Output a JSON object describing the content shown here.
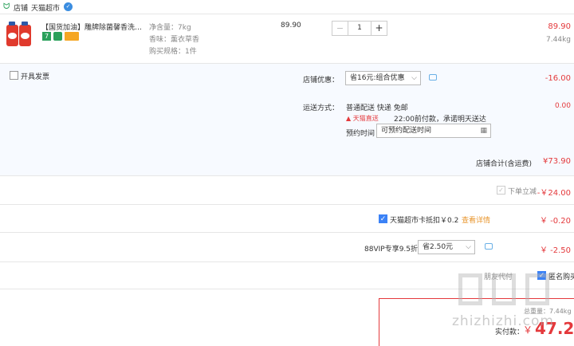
{
  "shop": {
    "icon": "tmall-cat-icon",
    "label": "店铺",
    "name": "天猫超市"
  },
  "item": {
    "title": "【国货加油】雕牌除菌馨香洗…",
    "spec1": "净含量：7kg",
    "spec2": "香味：薰衣草香",
    "spec3": "购买规格：1件",
    "unit_price": "89.90",
    "quantity": "1",
    "subtotal": "89.90",
    "weight": "7.44kg"
  },
  "invoice": {
    "label": "开具发票"
  },
  "discount": {
    "label": "店铺优惠：",
    "selected": "省16元:组合优惠",
    "amount": "-16.00"
  },
  "shipping": {
    "label": "运送方式：",
    "method": "普通配送 快递 免邮",
    "tmall_badge": "天猫直送",
    "promise": "22:00前付款，承诺明天送达",
    "appoint_label": "预约时间",
    "appoint_placeholder": "可预约配送时间",
    "amount": "0.00"
  },
  "shop_total": {
    "label": "店铺合计(含运费)",
    "amount": "¥73.90"
  },
  "instant": {
    "label": "下单立减",
    "amount": "-￥24.00"
  },
  "card": {
    "label": "天猫超市卡抵扣￥0.2",
    "link": "查看详情",
    "amount": "￥ -0.20"
  },
  "vip": {
    "label": "88VIP专享9.5折",
    "selected": "省2.50元",
    "amount": "￥ -2.50"
  },
  "footer": {
    "friend_pay": "朋友代付",
    "anon": "匿名购买",
    "weight": "总重量：7.44kg",
    "pay_label": "实付款：",
    "pay_currency": "￥",
    "pay_amount": "47.20"
  },
  "watermark": {
    "text": "zhizhizhi.com"
  }
}
